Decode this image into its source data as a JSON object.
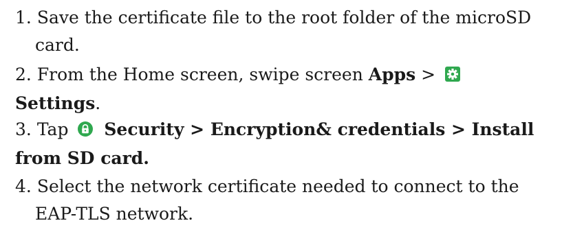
{
  "steps": [
    {
      "number": "1.",
      "line1": "Save the certificate file to the root folder of the microSD",
      "line2": "card."
    },
    {
      "number": "2.",
      "text_before": "From the Home screen, swipe screen",
      "bold_apps": "Apps",
      "separator": ">",
      "icon": "settings-gear-icon",
      "bold_settings": "Settings",
      "trailing": "."
    },
    {
      "number": "3.",
      "text_before": "Tap",
      "icon": "lock-icon",
      "bold_line1": "Security > Encryption& credentials > Install",
      "bold_line2": "from SD card."
    },
    {
      "number": "4.",
      "line1": "Select the network certificate needed to connect to the",
      "line2": "EAP-TLS network."
    }
  ],
  "colors": {
    "settings_icon_bg": "#2fa84f",
    "lock_icon_bg": "#2fa84f",
    "text": "#1a1a1a"
  }
}
